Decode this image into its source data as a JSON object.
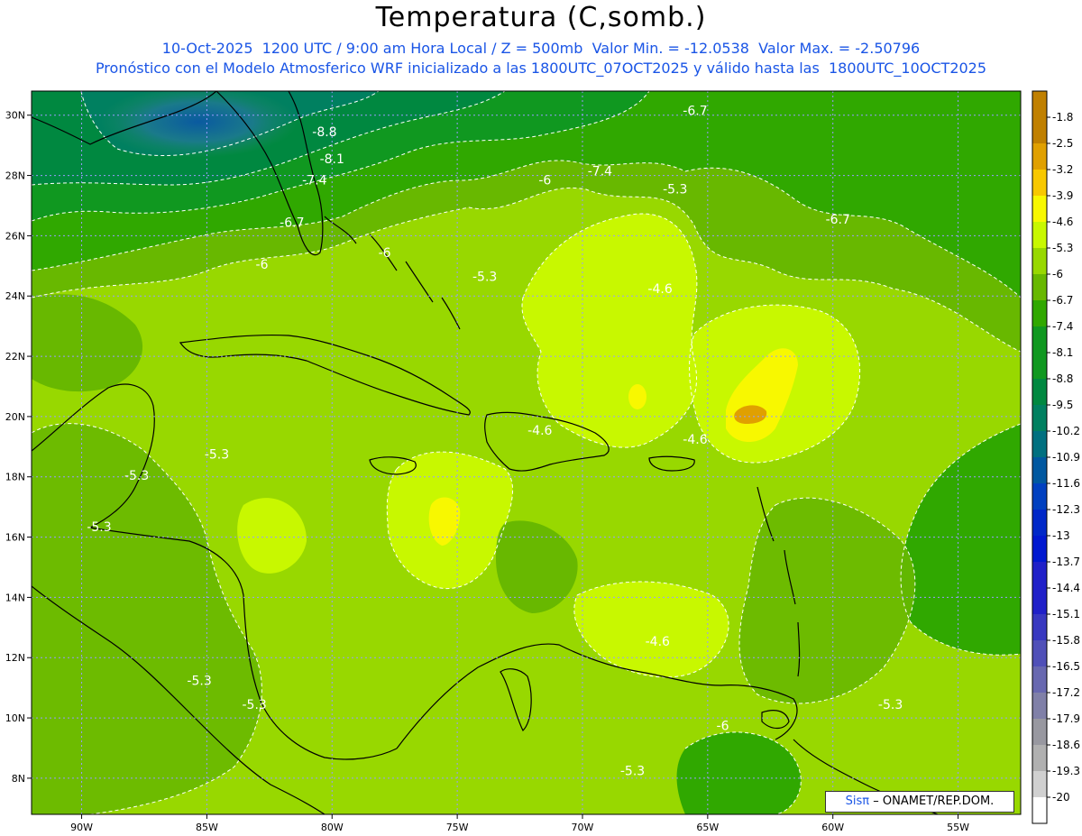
{
  "header": {
    "title": "Temperatura (C,somb.)",
    "line1": "10-Oct-2025  1200 UTC / 9:00 am Hora Local / Z = 500mb  Valor Min. = -12.0538  Valor Max. = -2.50796",
    "line2": "Pronóstico con el Modelo Atmosferico WRF inicializado a las 1800UTC_07OCT2025 y válido hasta las  1800UTC_10OCT2025"
  },
  "map": {
    "extent": {
      "lon": [
        -92,
        -52.5
      ],
      "lat": [
        6.8,
        30.8
      ]
    },
    "lat_ticks": [
      {
        "value": 30,
        "label": "30N"
      },
      {
        "value": 28,
        "label": "28N"
      },
      {
        "value": 26,
        "label": "26N"
      },
      {
        "value": 24,
        "label": "24N"
      },
      {
        "value": 22,
        "label": "22N"
      },
      {
        "value": 20,
        "label": "20N"
      },
      {
        "value": 18,
        "label": "18N"
      },
      {
        "value": 16,
        "label": "16N"
      },
      {
        "value": 14,
        "label": "14N"
      },
      {
        "value": 12,
        "label": "12N"
      },
      {
        "value": 10,
        "label": "10N"
      },
      {
        "value": 8,
        "label": "8N"
      }
    ],
    "lon_ticks": [
      {
        "value": -90,
        "label": "90W"
      },
      {
        "value": -85,
        "label": "85W"
      },
      {
        "value": -80,
        "label": "80W"
      },
      {
        "value": -75,
        "label": "75W"
      },
      {
        "value": -70,
        "label": "70W"
      },
      {
        "value": -65,
        "label": "65W"
      },
      {
        "value": -60,
        "label": "60W"
      },
      {
        "value": -55,
        "label": "55W"
      }
    ],
    "contour_labels": [
      {
        "text": "-6.7",
        "lon": -65.5,
        "lat": 30.0
      },
      {
        "text": "-8.8",
        "lon": -80.3,
        "lat": 29.3
      },
      {
        "text": "-8.1",
        "lon": -80.0,
        "lat": 28.4
      },
      {
        "text": "-7.4",
        "lon": -69.3,
        "lat": 28.0
      },
      {
        "text": "-7.4",
        "lon": -80.7,
        "lat": 27.7
      },
      {
        "text": "-6",
        "lon": -71.5,
        "lat": 27.7
      },
      {
        "text": "-5.3",
        "lon": -66.3,
        "lat": 27.4
      },
      {
        "text": "-6.7",
        "lon": -81.6,
        "lat": 26.3
      },
      {
        "text": "-6.7",
        "lon": -59.8,
        "lat": 26.4
      },
      {
        "text": "-6",
        "lon": -77.9,
        "lat": 25.3
      },
      {
        "text": "-6",
        "lon": -82.8,
        "lat": 24.9
      },
      {
        "text": "-5.3",
        "lon": -73.9,
        "lat": 24.5
      },
      {
        "text": "-4.6",
        "lon": -66.9,
        "lat": 24.1
      },
      {
        "text": "-4.6",
        "lon": -71.7,
        "lat": 19.4
      },
      {
        "text": "-4.6",
        "lon": -65.5,
        "lat": 19.1
      },
      {
        "text": "-5.3",
        "lon": -84.6,
        "lat": 18.6
      },
      {
        "text": "-5.3",
        "lon": -87.8,
        "lat": 17.9
      },
      {
        "text": "-5.3",
        "lon": -89.3,
        "lat": 16.2
      },
      {
        "text": "-4.6",
        "lon": -67.0,
        "lat": 12.4
      },
      {
        "text": "-5.3",
        "lon": -85.3,
        "lat": 11.1
      },
      {
        "text": "-5.3",
        "lon": -83.1,
        "lat": 10.3
      },
      {
        "text": "-6",
        "lon": -64.4,
        "lat": 9.6
      },
      {
        "text": "-5.3",
        "lon": -57.7,
        "lat": 10.3
      },
      {
        "text": "-5.3",
        "lon": -68.0,
        "lat": 8.1
      }
    ]
  },
  "colorbar": {
    "colors": [
      "#c08000",
      "#e0a000",
      "#f8c800",
      "#f8f800",
      "#c8f800",
      "#98d800",
      "#68b800",
      "#30a800",
      "#109820",
      "#008840",
      "#008060",
      "#007080",
      "#0058a0",
      "#0040c0",
      "#0028c8",
      "#0018d0",
      "#2020c8",
      "#3838c0",
      "#5050b8",
      "#6868b0",
      "#8080a8",
      "#9898a0",
      "#b0b0b0",
      "#d0d0d0",
      "#ffffff"
    ],
    "labels": [
      "-1.8",
      "-2.5",
      "-3.2",
      "-3.9",
      "-4.6",
      "-5.3",
      "-6",
      "-6.7",
      "-7.4",
      "-8.1",
      "-8.8",
      "-9.5",
      "-10.2",
      "-10.9",
      "-11.6",
      "-12.3",
      "-13",
      "-13.7",
      "-14.4",
      "-15.1",
      "-15.8",
      "-16.5",
      "-17.2",
      "-17.9",
      "-18.6",
      "-19.3",
      "-20"
    ]
  },
  "credit": {
    "sis": "Sisπ",
    "rest": "– ONAMET/REP.DOM."
  }
}
